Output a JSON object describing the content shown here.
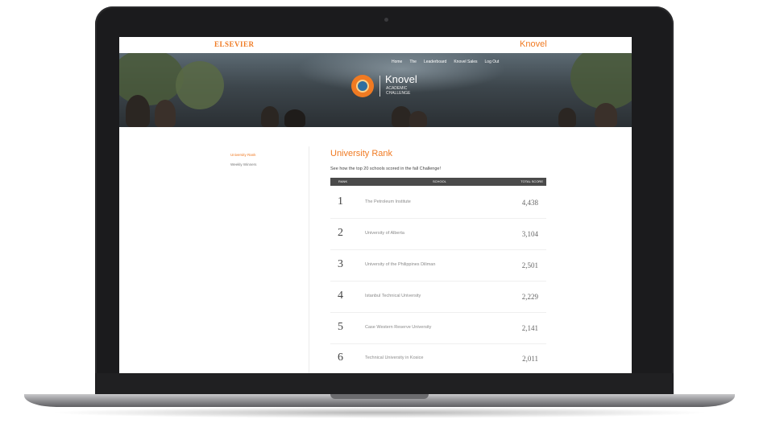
{
  "header": {
    "elsevier": "ELSEVIER",
    "brand": "Knovel"
  },
  "nav": [
    "Home",
    "The",
    "Leaderboard",
    "Knovel Sales",
    "Log Out"
  ],
  "logo": {
    "name": "Knovel",
    "subtitle": "ACADEMIC\nCHALLENGE"
  },
  "sidebar": {
    "items": [
      "University Rank",
      "Weekly Winners"
    ]
  },
  "main": {
    "title": "University Rank",
    "subtitle": "See how the top 20 schools scored in the fall Challenge!",
    "columns": {
      "rank": "RANK",
      "school": "SCHOOL",
      "score": "TOTAL SCORE"
    },
    "rows": [
      {
        "rank": "1",
        "school": "The Petroleum Institute",
        "score": "4,438"
      },
      {
        "rank": "2",
        "school": "University of Alberta",
        "score": "3,104"
      },
      {
        "rank": "3",
        "school": "University of the Philippines Diliman",
        "score": "2,501"
      },
      {
        "rank": "4",
        "school": "Istanbul Technical University",
        "score": "2,229"
      },
      {
        "rank": "5",
        "school": "Case Western Reserve University",
        "score": "2,141"
      },
      {
        "rank": "6",
        "school": "Technical University in Kosice",
        "score": "2,011"
      }
    ]
  },
  "colors": {
    "accent": "#f07a22",
    "table_header": "#4a4a4a"
  }
}
